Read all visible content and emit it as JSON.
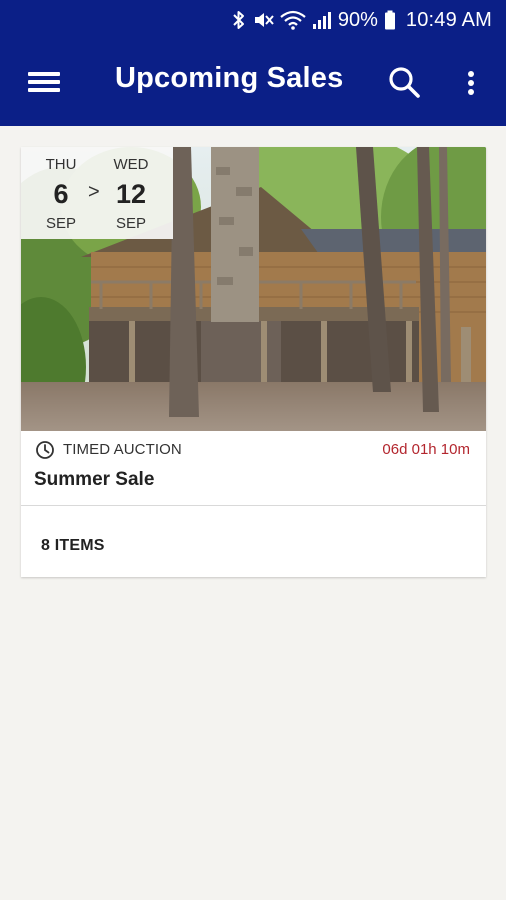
{
  "status_bar": {
    "battery": "90%",
    "time": "10:49 AM",
    "icons": [
      "bluetooth-icon",
      "mute-vibrate-icon",
      "wifi-icon",
      "cell-signal-icon",
      "battery-icon"
    ]
  },
  "app_bar": {
    "title": "Upcoming Sales",
    "icons": [
      "menu-icon",
      "search-icon",
      "more-vert-icon"
    ]
  },
  "sale": {
    "start": {
      "dow": "THU",
      "day": "6",
      "month": "SEP"
    },
    "arrow": ">",
    "end": {
      "dow": "WED",
      "day": "12",
      "month": "SEP"
    },
    "type_icon": "clock-icon",
    "type": "TIMED AUCTION",
    "countdown": "06d 01h 10m",
    "title": "Summer Sale",
    "items": "8 ITEMS"
  },
  "colors": {
    "app_bar": "#0b1f87",
    "background": "#f4f3f0",
    "countdown": "#b3262e"
  }
}
